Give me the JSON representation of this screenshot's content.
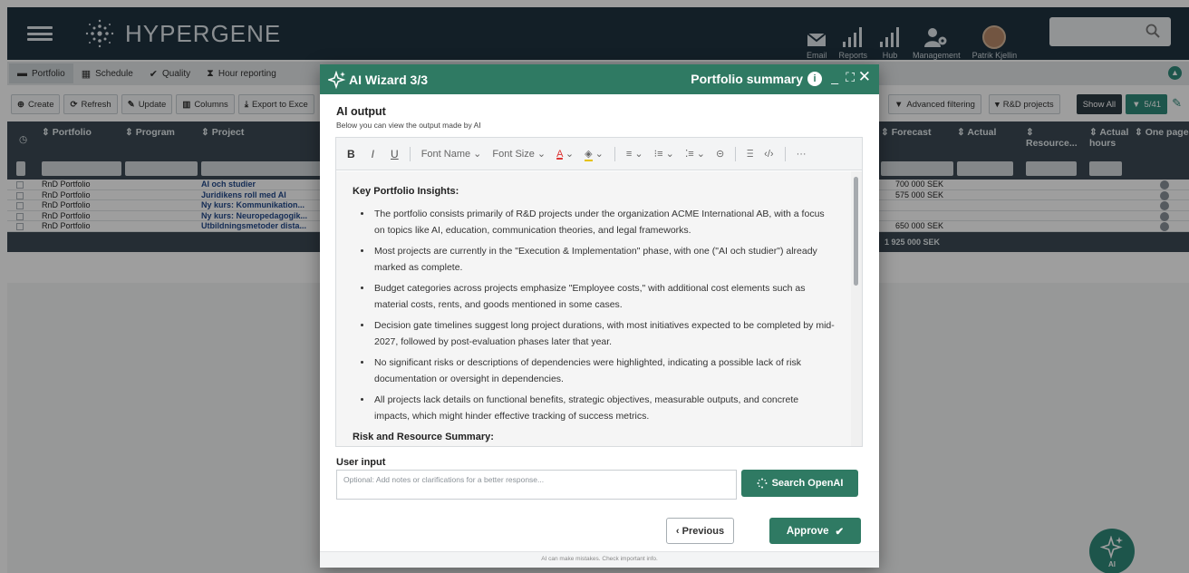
{
  "app": {
    "name": "HYPERGENE",
    "nav": [
      {
        "label": "Email",
        "icon": "mail-icon"
      },
      {
        "label": "Reports",
        "icon": "bar-chart-icon"
      },
      {
        "label": "Hub",
        "icon": "bar-chart-icon"
      },
      {
        "label": "Management",
        "icon": "user-gear-icon"
      },
      {
        "label": "Patrik Kjellin",
        "icon": "avatar"
      }
    ],
    "search_placeholder": ""
  },
  "tabs": [
    {
      "label": "Portfolio",
      "icon": "briefcase-icon",
      "active": true
    },
    {
      "label": "Schedule",
      "icon": "calendar-icon"
    },
    {
      "label": "Quality",
      "icon": "check-icon"
    },
    {
      "label": "Hour reporting",
      "icon": "hourglass-icon"
    }
  ],
  "toolbar": {
    "create": "Create",
    "refresh": "Refresh",
    "update": "Update",
    "columns": "Columns",
    "export": "Export to Exce",
    "advanced_filtering": "Advanced filtering",
    "rnd_projects": "R&D projects",
    "show_all": "Show All",
    "filter_count": "5/41"
  },
  "grid": {
    "headers": {
      "portfolio": "Portfolio",
      "program": "Program",
      "project": "Project",
      "forecast": "Forecast",
      "actual": "Actual",
      "resource": "Resource...",
      "actual_hours": "Actual hours",
      "one_page": "One page"
    },
    "rows": [
      {
        "portfolio": "RnD Portfolio",
        "project": "AI och studier",
        "forecast": "700 000 SEK"
      },
      {
        "portfolio": "RnD Portfolio",
        "project": "Juridikens roll med AI",
        "forecast": "575 000 SEK"
      },
      {
        "portfolio": "RnD Portfolio",
        "project": "Ny kurs: Kommunikation...",
        "forecast": ""
      },
      {
        "portfolio": "RnD Portfolio",
        "project": "Ny kurs: Neuropedagogik...",
        "forecast": ""
      },
      {
        "portfolio": "RnD Portfolio",
        "project": "Utbildningsmetoder dista...",
        "forecast": "650 000 SEK"
      }
    ],
    "total_forecast": "1 925 000 SEK"
  },
  "fab": {
    "label": "AI"
  },
  "modal": {
    "title": "AI Wizard 3/3",
    "right_title": "Portfolio summary",
    "section_title": "AI output",
    "section_subtitle": "Below you can view the output made by AI",
    "editor_toolbar": {
      "bold": "B",
      "italic": "I",
      "underline": "U",
      "font_name": "Font Name",
      "font_size": "Font Size",
      "font_color": "A",
      "more": "···"
    },
    "content": {
      "heading1": "Key Portfolio Insights:",
      "bullets": [
        "The portfolio consists primarily of R&D projects under the organization ACME International AB, with a focus on topics like AI, education, communication theories, and legal frameworks.",
        "Most projects are currently in the \"Execution & Implementation\" phase, with one (\"AI och studier\") already marked as complete.",
        "Budget categories across projects emphasize \"Employee costs,\" with additional cost elements such as material costs, rents, and goods mentioned in some cases.",
        "Decision gate timelines suggest long project durations, with most initiatives expected to be completed by mid-2027, followed by post-evaluation phases later that year.",
        "No significant risks or descriptions of dependencies were highlighted, indicating a possible lack of risk documentation or oversight in dependencies.",
        "All projects lack details on functional benefits, strategic objectives, measurable outputs, and concrete impacts, which might hinder effective tracking of success metrics."
      ],
      "heading2": "Risk and Resource Summary:"
    },
    "user_input_label": "User input",
    "user_input_placeholder": "Optional: Add notes or clarifications for a better response...",
    "search_button": "Search OpenAI",
    "previous_button": "‹  Previous",
    "approve_button": "Approve",
    "disclaimer": "AI can make mistakes. Check important info."
  }
}
